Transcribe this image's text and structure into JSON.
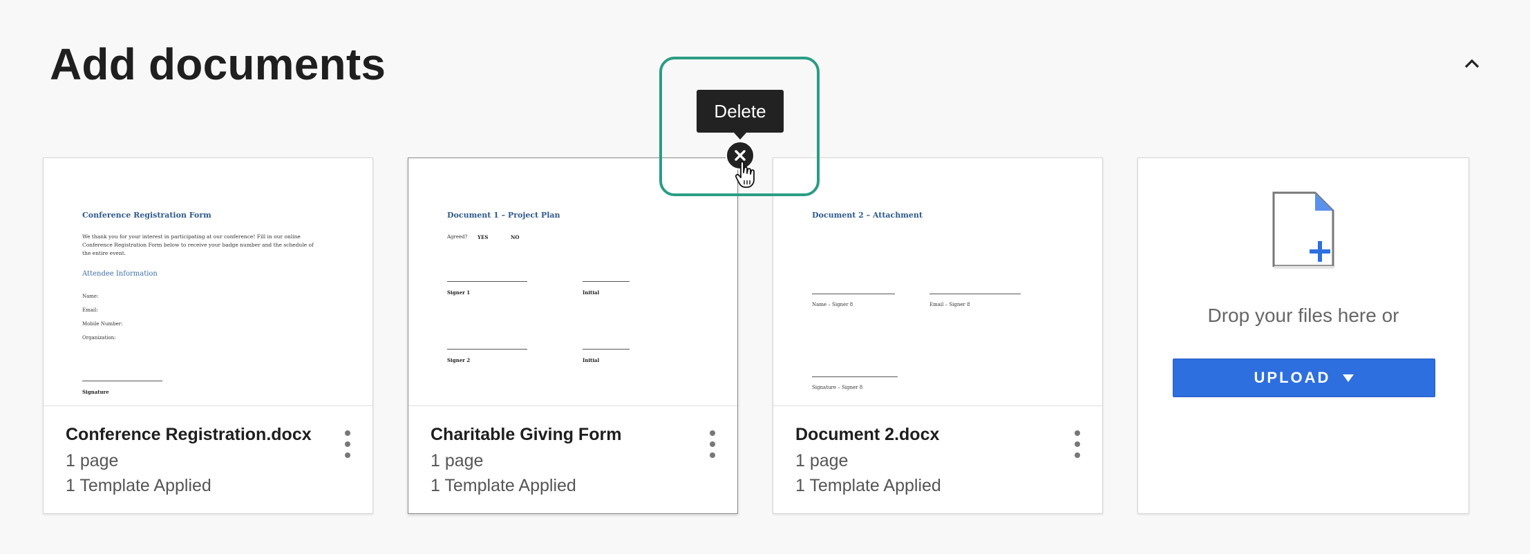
{
  "header": {
    "title": "Add documents",
    "collapse_icon": "chevron-up-icon"
  },
  "documents": [
    {
      "name": "Conference Registration.docx",
      "pages": "1 page",
      "templates": "1 Template Applied",
      "preview": {
        "title": "Conference Registration Form",
        "intro": "We thank you for your interest in participating at our conference! Fill in our online Conference Registration Form below to receive your badge number and the schedule of the entire event.",
        "section": "Attendee Information",
        "fields": [
          "Name:",
          "Email:",
          "Mobile Number:",
          "Organization:"
        ],
        "signature": "Signature"
      }
    },
    {
      "name": "Charitable Giving Form",
      "pages": "1 page",
      "templates": "1 Template Applied",
      "preview": {
        "title": "Document 1 – Project Plan",
        "agreed": "Agreed?",
        "yes": "YES",
        "no": "NO",
        "signer1": "Signer 1",
        "initial1": "Initial",
        "signer2": "Signer 2",
        "initial2": "Initial"
      }
    },
    {
      "name": "Document 2.docx",
      "pages": "1 page",
      "templates": "1 Template Applied",
      "preview": {
        "title": "Document 2 – Attachment",
        "name_label": "Name – Signer 8",
        "email_label": "Email – Signer 8",
        "sig_label": "Signature – Signer 8"
      }
    }
  ],
  "upload": {
    "drop_text": "Drop your files here or",
    "button_label": "UPLOAD",
    "icon": "file-add-icon",
    "dropdown_icon": "triangle-down-icon"
  },
  "tooltip": {
    "label": "Delete"
  },
  "colors": {
    "accent": "#2d6fdf",
    "highlight": "#2a9d84",
    "tooltip_bg": "#222222",
    "doc_heading": "#2e5a8c"
  }
}
